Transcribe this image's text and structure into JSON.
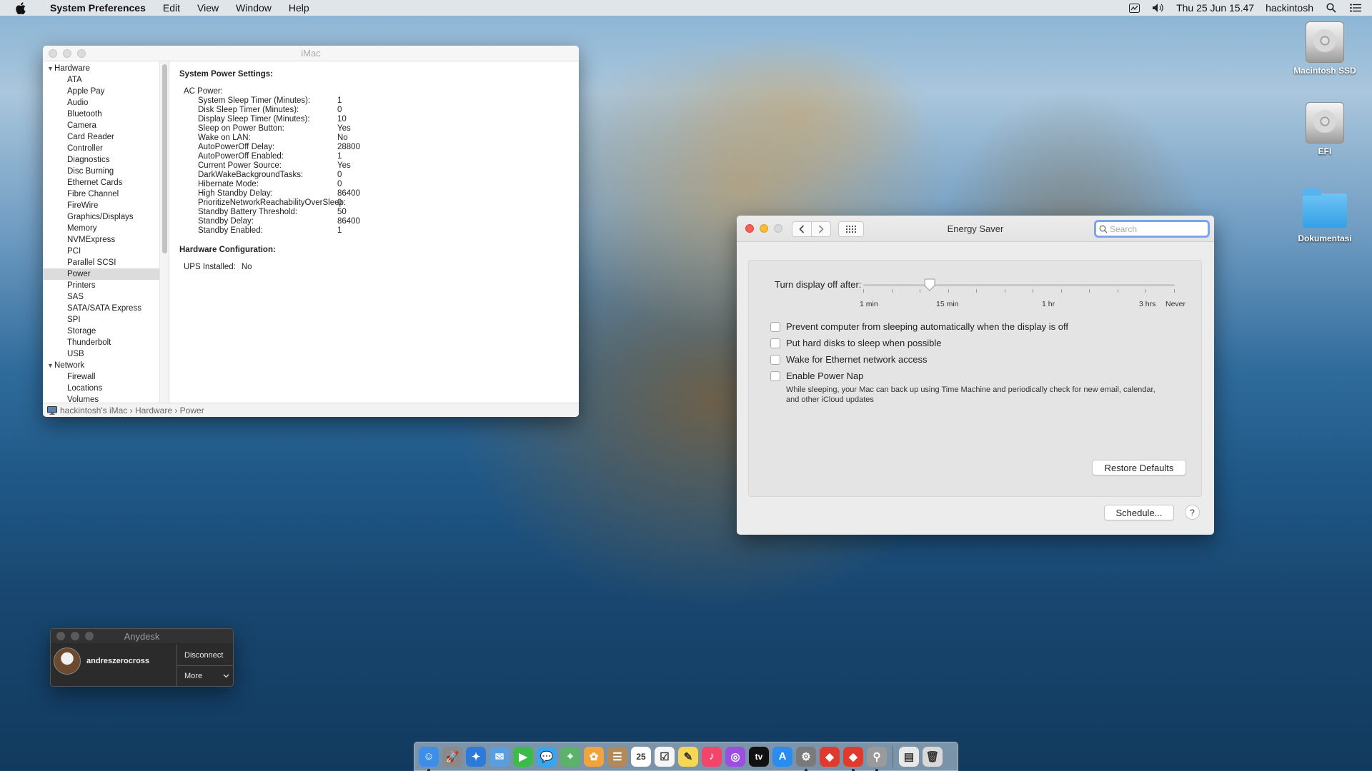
{
  "menubar": {
    "app_name": "System Preferences",
    "items": [
      "Edit",
      "View",
      "Window",
      "Help"
    ],
    "datetime": "Thu 25 Jun  15.47",
    "user": "hackintosh"
  },
  "desktop_icons": [
    {
      "label": "Macintosh SSD"
    },
    {
      "label": "EFI"
    },
    {
      "label": "Dokumentasi"
    }
  ],
  "system_info": {
    "title": "iMac",
    "sidebar": {
      "hardware_label": "Hardware",
      "hardware_items": [
        "ATA",
        "Apple Pay",
        "Audio",
        "Bluetooth",
        "Camera",
        "Card Reader",
        "Controller",
        "Diagnostics",
        "Disc Burning",
        "Ethernet Cards",
        "Fibre Channel",
        "FireWire",
        "Graphics/Displays",
        "Memory",
        "NVMExpress",
        "PCI",
        "Parallel SCSI",
        "Power",
        "Printers",
        "SAS",
        "SATA/SATA Express",
        "SPI",
        "Storage",
        "Thunderbolt",
        "USB"
      ],
      "network_label": "Network",
      "network_items": [
        "Firewall",
        "Locations",
        "Volumes"
      ]
    },
    "content": {
      "heading": "System Power Settings:",
      "ac_label": "AC Power:",
      "settings": [
        {
          "k": "System Sleep Timer (Minutes):",
          "v": "1"
        },
        {
          "k": "Disk Sleep Timer (Minutes):",
          "v": "0"
        },
        {
          "k": "Display Sleep Timer (Minutes):",
          "v": "10"
        },
        {
          "k": "Sleep on Power Button:",
          "v": "Yes"
        },
        {
          "k": "Wake on LAN:",
          "v": "No"
        },
        {
          "k": "AutoPowerOff Delay:",
          "v": "28800"
        },
        {
          "k": "AutoPowerOff Enabled:",
          "v": "1"
        },
        {
          "k": "Current Power Source:",
          "v": "Yes"
        },
        {
          "k": "DarkWakeBackgroundTasks:",
          "v": "0"
        },
        {
          "k": "Hibernate Mode:",
          "v": "0"
        },
        {
          "k": "High Standby Delay:",
          "v": "86400"
        },
        {
          "k": "PrioritizeNetworkReachabilityOverSleep:",
          "v": "0"
        },
        {
          "k": "Standby Battery Threshold:",
          "v": "50"
        },
        {
          "k": "Standby Delay:",
          "v": "86400"
        },
        {
          "k": "Standby Enabled:",
          "v": "1"
        }
      ],
      "hw_heading": "Hardware Configuration:",
      "ups_label": "UPS Installed:",
      "ups_value": "No"
    },
    "breadcrumb": "hackintosh's iMac  ›  Hardware  ›  Power"
  },
  "energy_saver": {
    "title": "Energy Saver",
    "search_placeholder": "Search",
    "slider_label": "Turn display off after:",
    "slider_marks": [
      "1 min",
      "15 min",
      "1 hr",
      "3 hrs",
      "Never"
    ],
    "slider_selected": "15 min",
    "checkboxes": [
      {
        "label": "Prevent computer from sleeping automatically when the display is off",
        "checked": false
      },
      {
        "label": "Put hard disks to sleep when possible",
        "checked": false
      },
      {
        "label": "Wake for Ethernet network access",
        "checked": false
      },
      {
        "label": "Enable Power Nap",
        "checked": false
      }
    ],
    "power_nap_desc": "While sleeping, your Mac can back up using Time Machine and periodically check for new email, calendar, and other iCloud updates",
    "restore_label": "Restore Defaults",
    "schedule_label": "Schedule...",
    "help_label": "?"
  },
  "anydesk": {
    "title": "Anydesk",
    "user": "andreszerocross",
    "disconnect_label": "Disconnect",
    "more_label": "More"
  },
  "dock": {
    "apps": [
      {
        "icon": "finder-icon",
        "color": "#3d8ee8",
        "glyph": "☺",
        "running": true
      },
      {
        "icon": "launchpad-icon",
        "color": "#8a8a8a",
        "glyph": "🚀",
        "running": false
      },
      {
        "icon": "safari-icon",
        "color": "#2d7ad9",
        "glyph": "✦",
        "running": false
      },
      {
        "icon": "mail-icon",
        "color": "#5a9ee0",
        "glyph": "✉",
        "running": false
      },
      {
        "icon": "facetime-icon",
        "color": "#3cba4a",
        "glyph": "▶",
        "running": false
      },
      {
        "icon": "messages-icon",
        "color": "#36a6f0",
        "glyph": "💬",
        "running": false
      },
      {
        "icon": "maps-icon",
        "color": "#5bb36b",
        "glyph": "⌖",
        "running": false
      },
      {
        "icon": "photos-icon",
        "color": "#f2a33c",
        "glyph": "✿",
        "running": false
      },
      {
        "icon": "contacts-icon",
        "color": "#b08a5a",
        "glyph": "☰",
        "running": false
      },
      {
        "icon": "calendar-icon",
        "color": "#ffffff",
        "glyph": "25",
        "running": false
      },
      {
        "icon": "reminders-icon",
        "color": "#f5f5f5",
        "glyph": "☑",
        "running": false
      },
      {
        "icon": "notes-icon",
        "color": "#f6d653",
        "glyph": "✎",
        "running": false
      },
      {
        "icon": "music-icon",
        "color": "#f3456a",
        "glyph": "♪",
        "running": false
      },
      {
        "icon": "podcasts-icon",
        "color": "#9b4ee0",
        "glyph": "◎",
        "running": false
      },
      {
        "icon": "tv-icon",
        "color": "#111111",
        "glyph": "tv",
        "running": false
      },
      {
        "icon": "app-store-icon",
        "color": "#2a8cf0",
        "glyph": "A",
        "running": false
      },
      {
        "icon": "system-preferences-icon",
        "color": "#7a7a7a",
        "glyph": "⚙",
        "running": true
      },
      {
        "icon": "anydesk-icon",
        "color": "#e03a2f",
        "glyph": "◆",
        "running": false
      },
      {
        "icon": "anydesk-alt-icon",
        "color": "#e03a2f",
        "glyph": "◆",
        "running": true
      },
      {
        "icon": "system-information-icon",
        "color": "#9a9a9a",
        "glyph": "⚲",
        "running": true
      }
    ],
    "right": [
      {
        "icon": "downloads-icon",
        "color": "#e8e8e8",
        "glyph": "▤"
      },
      {
        "icon": "trash-icon",
        "color": "#d8d8d8",
        "glyph": "🗑"
      }
    ]
  }
}
